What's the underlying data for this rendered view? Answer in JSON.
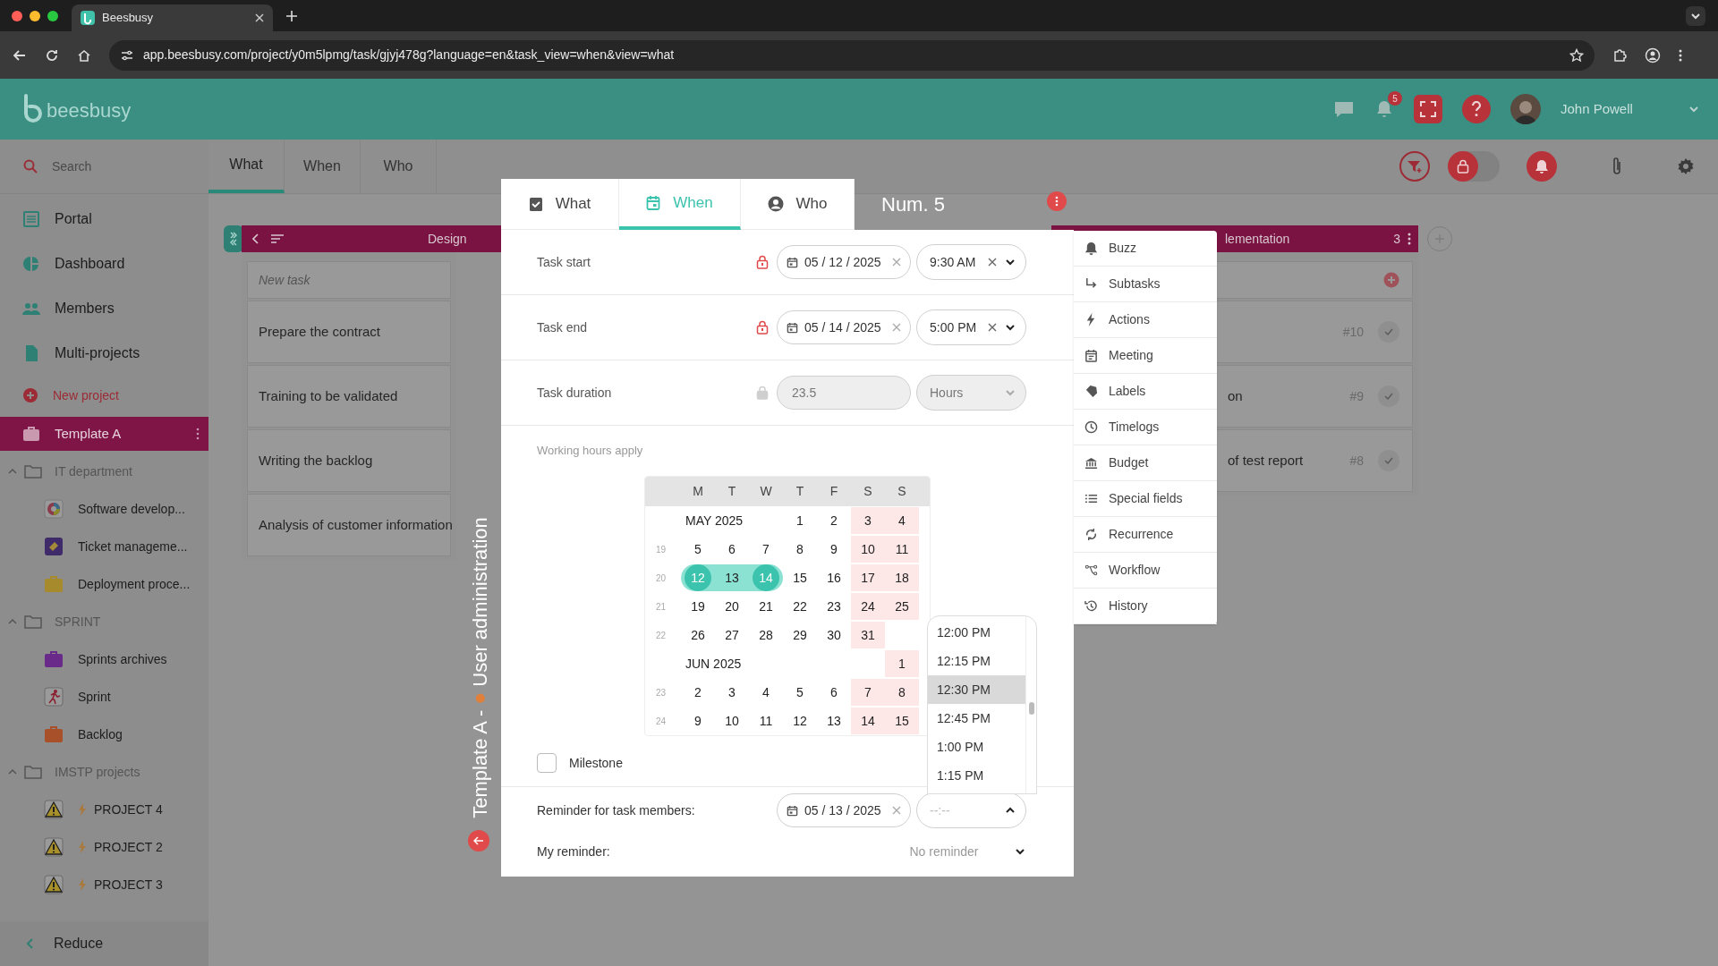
{
  "browser": {
    "tab_title": "Beesbusy",
    "url": "app.beesbusy.com/project/y0m5lpmg/task/gjyj478g?language=en&task_view=when&view=what"
  },
  "header": {
    "logo": "beesbusy",
    "notification_count": "5",
    "user_name": "John Powell"
  },
  "sidebar": {
    "search_placeholder": "Search",
    "items": [
      {
        "kind": "nav",
        "label": "Portal",
        "selected": false
      },
      {
        "kind": "nav",
        "label": "Dashboard",
        "selected": false
      },
      {
        "kind": "nav",
        "label": "Members",
        "selected": false
      },
      {
        "kind": "nav",
        "label": "Multi-projects",
        "selected": false
      },
      {
        "kind": "new",
        "label": "New project",
        "selected": false
      },
      {
        "kind": "project",
        "label": "Template A",
        "selected": true
      },
      {
        "kind": "folder",
        "label": "IT department",
        "expanded": true,
        "selected": false,
        "children": [
          {
            "kind": "wheel",
            "label": "Software develop...",
            "selected": false
          },
          {
            "kind": "ticket",
            "label": "Ticket manageme...",
            "selected": false
          },
          {
            "kind": "briefcase",
            "label": "Deployment proce...",
            "color": "#a68a2c",
            "selected": false
          }
        ]
      },
      {
        "kind": "folder",
        "label": "SPRINT",
        "expanded": true,
        "selected": false,
        "children": [
          {
            "kind": "briefcase",
            "label": "Sprints archives",
            "color": "#6a2a8a",
            "selected": false
          },
          {
            "kind": "runner",
            "label": "Sprint",
            "selected": false
          },
          {
            "kind": "briefcase",
            "label": "Backlog",
            "color": "#a8502a",
            "selected": false
          }
        ]
      },
      {
        "kind": "folder",
        "label": "IMSTP projects",
        "expanded": true,
        "selected": false,
        "children": [
          {
            "kind": "warning",
            "label": "PROJECT 4",
            "selected": false
          },
          {
            "kind": "warning",
            "label": "PROJECT 2",
            "selected": false
          },
          {
            "kind": "warning",
            "label": "PROJECT 3",
            "selected": false
          }
        ]
      }
    ],
    "footer": "Reduce"
  },
  "toolbar": {
    "lock_on": false
  },
  "main_tabs": [
    {
      "label": "What",
      "selected": true
    },
    {
      "label": "When",
      "selected": false
    },
    {
      "label": "Who",
      "selected": false
    }
  ],
  "board": {
    "columns": [
      {
        "title": "Design",
        "new_task_placeholder": "New task",
        "cards": [
          {
            "title": "Prepare the contract"
          },
          {
            "title": "Training to be validated"
          },
          {
            "title": "Writing the backlog"
          },
          {
            "title": "Analysis of customer information"
          }
        ]
      },
      {
        "title": "lementation",
        "count": "3",
        "cards": [
          {
            "number": "#10"
          },
          {
            "title": "on",
            "number": "#9"
          },
          {
            "title": "of test report",
            "number": "#8"
          }
        ]
      }
    ]
  },
  "vertical_label": {
    "project": "Template A -",
    "task": "User administration"
  },
  "modal": {
    "tabs": [
      {
        "label": "What",
        "selected": false
      },
      {
        "label": "When",
        "selected": true
      },
      {
        "label": "Who",
        "selected": false
      }
    ],
    "number": "Num. 5",
    "rows": [
      {
        "kind": "datetime",
        "label": "Task start",
        "lock_active": true,
        "date": "05 / 12 / 2025",
        "time": "9:30 AM"
      },
      {
        "kind": "datetime",
        "label": "Task end",
        "lock_active": true,
        "date": "05 / 14 / 2025",
        "time": "5:00 PM"
      },
      {
        "kind": "duration",
        "label": "Task duration",
        "lock_active": false,
        "value": "23.5",
        "unit": "Hours"
      }
    ],
    "note": "Working hours apply",
    "calendar": {
      "weekdays": [
        "M",
        "T",
        "W",
        "T",
        "F",
        "S",
        "S"
      ],
      "rows": [
        {
          "month": "MAY 2025",
          "days": [
            {
              "d": "1",
              "selected": false
            },
            {
              "d": "2",
              "selected": false
            },
            {
              "d": "3",
              "selected": false
            },
            {
              "d": "4",
              "selected": false
            }
          ]
        },
        {
          "week": "19",
          "days": [
            {
              "d": "5",
              "selected": false
            },
            {
              "d": "6",
              "selected": false
            },
            {
              "d": "7",
              "selected": false
            },
            {
              "d": "8",
              "selected": false
            },
            {
              "d": "9",
              "selected": false
            },
            {
              "d": "10",
              "selected": false
            },
            {
              "d": "11",
              "selected": false
            }
          ]
        },
        {
          "week": "20",
          "days": [
            {
              "d": "12",
              "selected": true
            },
            {
              "d": "13",
              "selected": true
            },
            {
              "d": "14",
              "selected": true
            },
            {
              "d": "15",
              "selected": false
            },
            {
              "d": "16",
              "selected": false
            },
            {
              "d": "17",
              "selected": false
            },
            {
              "d": "18",
              "selected": false
            }
          ]
        },
        {
          "week": "21",
          "days": [
            {
              "d": "19",
              "selected": false
            },
            {
              "d": "20",
              "selected": false
            },
            {
              "d": "21",
              "selected": false
            },
            {
              "d": "22",
              "selected": false
            },
            {
              "d": "23",
              "selected": false
            },
            {
              "d": "24",
              "selected": false
            },
            {
              "d": "25",
              "selected": false
            }
          ]
        },
        {
          "week": "22",
          "days": [
            {
              "d": "26",
              "selected": false
            },
            {
              "d": "27",
              "selected": false
            },
            {
              "d": "28",
              "selected": false
            },
            {
              "d": "29",
              "selected": false
            },
            {
              "d": "30",
              "selected": false
            },
            {
              "d": "31",
              "selected": false
            }
          ]
        },
        {
          "month": "JUN 2025",
          "days": [
            {
              "d": "1",
              "selected": false
            }
          ]
        },
        {
          "week": "23",
          "days": [
            {
              "d": "2",
              "selected": false
            },
            {
              "d": "3",
              "selected": false
            },
            {
              "d": "4",
              "selected": false
            },
            {
              "d": "5",
              "selected": false
            },
            {
              "d": "6",
              "selected": false
            },
            {
              "d": "7",
              "selected": false
            },
            {
              "d": "8",
              "selected": false
            }
          ]
        },
        {
          "week": "24",
          "days": [
            {
              "d": "9",
              "selected": false
            },
            {
              "d": "10",
              "selected": false
            },
            {
              "d": "11",
              "selected": false
            },
            {
              "d": "12",
              "selected": false
            },
            {
              "d": "13",
              "selected": false
            },
            {
              "d": "14",
              "selected": false
            },
            {
              "d": "15",
              "selected": false
            }
          ]
        }
      ]
    },
    "milestone": {
      "label": "Milestone",
      "checked": false
    },
    "reminder": {
      "label": "Reminder for task members:",
      "date": "05 / 13 / 2025",
      "time_placeholder": "--:--",
      "expanded": true,
      "time_options": [
        {
          "label": "12:00 PM",
          "selected": false
        },
        {
          "label": "12:15 PM",
          "selected": false
        },
        {
          "label": "12:30 PM",
          "selected": true
        },
        {
          "label": "12:45 PM",
          "selected": false
        },
        {
          "label": "1:00 PM",
          "selected": false
        },
        {
          "label": "1:15 PM",
          "selected": false
        }
      ]
    },
    "my_reminder": {
      "label": "My reminder:",
      "value": "No reminder"
    },
    "side_menu": [
      "Buzz",
      "Subtasks",
      "Actions",
      "Meeting",
      "Labels",
      "Timelogs",
      "Budget",
      "Special fields",
      "Recurrence",
      "Workflow",
      "History"
    ]
  }
}
